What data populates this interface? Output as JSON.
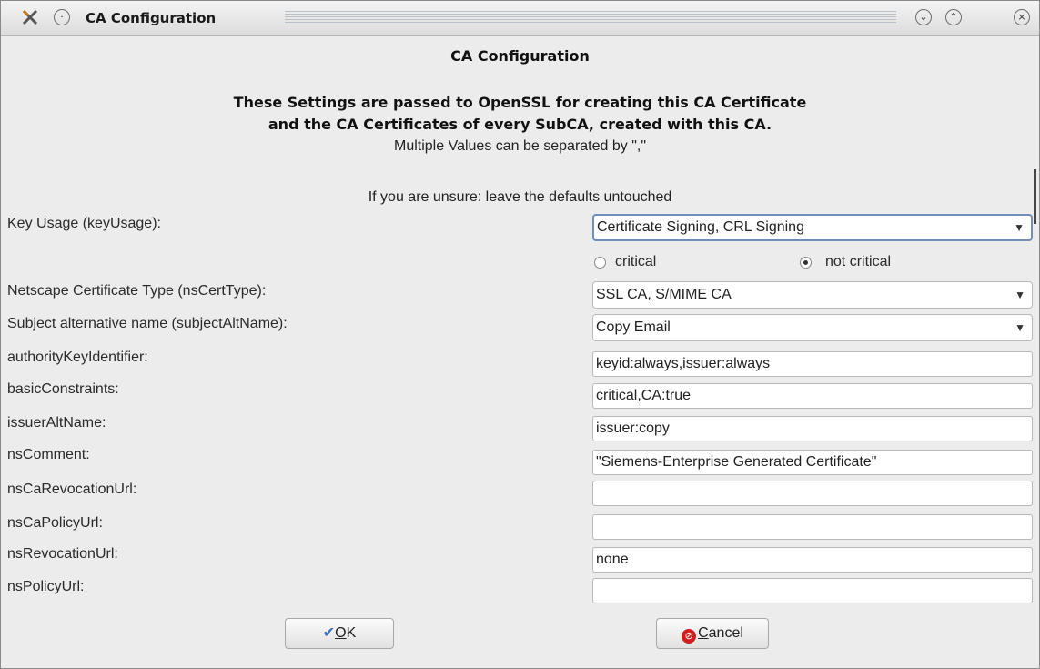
{
  "window": {
    "title": "CA Configuration",
    "icons": [
      "app-icon",
      "sticky-icon",
      "minimize-icon",
      "maximize-icon",
      "close-icon"
    ]
  },
  "header": {
    "title": "CA Configuration",
    "line1": "These Settings are passed to OpenSSL for creating this CA Certificate",
    "line2": "and the CA Certificates of every SubCA, created with this CA.",
    "note": "Multiple Values can be separated by \",\"",
    "hint": "If you are unsure: leave the defaults untouched"
  },
  "fields": {
    "keyUsage": {
      "label": "Key Usage (keyUsage):",
      "value": "Certificate Signing, CRL Signing"
    },
    "critical": {
      "option1": "critical",
      "option2": "not critical",
      "selected": "not critical"
    },
    "nsCertType": {
      "label": "Netscape Certificate Type (nsCertType):",
      "value": "SSL CA, S/MIME CA"
    },
    "subjectAltName": {
      "label": "Subject alternative name (subjectAltName):",
      "value": "Copy Email"
    },
    "authorityKeyIdentifier": {
      "label": "authorityKeyIdentifier:",
      "value": "keyid:always,issuer:always"
    },
    "basicConstraints": {
      "label": "basicConstraints:",
      "value": "critical,CA:true"
    },
    "issuerAltName": {
      "label": "issuerAltName:",
      "value": "issuer:copy"
    },
    "nsComment": {
      "label": "nsComment:",
      "value": "\"Siemens-Enterprise Generated Certificate\""
    },
    "nsCaRevocationUrl": {
      "label": "nsCaRevocationUrl:",
      "value": ""
    },
    "nsCaPolicyUrl": {
      "label": "nsCaPolicyUrl:",
      "value": ""
    },
    "nsRevocationUrl": {
      "label": "nsRevocationUrl:",
      "value": "none"
    },
    "nsPolicyUrl": {
      "label": "nsPolicyUrl:",
      "value": ""
    }
  },
  "buttons": {
    "ok": {
      "accel": "O",
      "rest": "K"
    },
    "cancel": {
      "accel": "C",
      "rest": "ancel"
    }
  },
  "colors": {
    "accent": "#6f8fbf",
    "cancel_icon": "#d11d1d",
    "ok_icon": "#3e6fc2"
  }
}
